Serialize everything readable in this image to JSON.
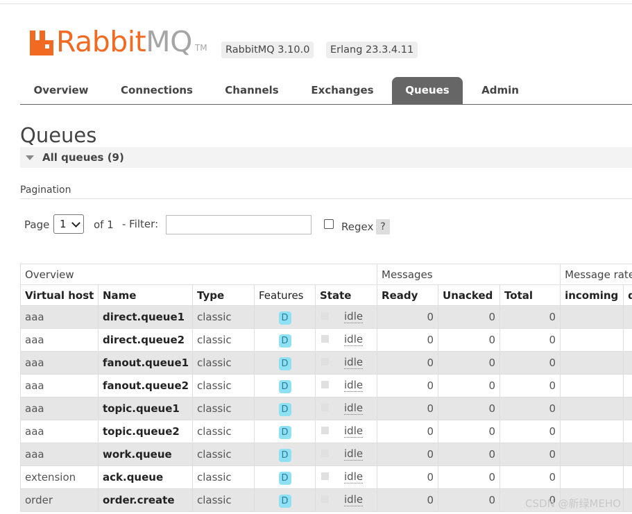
{
  "header": {
    "logo": {
      "brand": "Rabbit",
      "product": "MQ",
      "tm": "TM"
    },
    "version_badge": "RabbitMQ 3.10.0",
    "erlang_badge": "Erlang 23.3.4.11"
  },
  "tabs": [
    {
      "label": "Overview",
      "active": false
    },
    {
      "label": "Connections",
      "active": false
    },
    {
      "label": "Channels",
      "active": false
    },
    {
      "label": "Exchanges",
      "active": false
    },
    {
      "label": "Queues",
      "active": true
    },
    {
      "label": "Admin",
      "active": false
    }
  ],
  "page_title": "Queues",
  "section": {
    "title": "All queues (9)"
  },
  "pagination": {
    "label": "Pagination",
    "page_label": "Page",
    "page_value": "1",
    "of_label": "of 1",
    "filter_label": "- Filter:",
    "filter_value": "",
    "regex_label": "Regex",
    "regex_checked": false,
    "help_label": "?"
  },
  "table": {
    "groups": [
      "Overview",
      "Messages",
      "Message rate"
    ],
    "columns": [
      "Virtual host",
      "Name",
      "Type",
      "Features",
      "State",
      "Ready",
      "Unacked",
      "Total",
      "incoming",
      "d"
    ],
    "rows": [
      {
        "vhost": "aaa",
        "name": "direct.queue1",
        "type": "classic",
        "feature": "D",
        "state": "idle",
        "ready": "0",
        "unacked": "0",
        "total": "0"
      },
      {
        "vhost": "aaa",
        "name": "direct.queue2",
        "type": "classic",
        "feature": "D",
        "state": "idle",
        "ready": "0",
        "unacked": "0",
        "total": "0"
      },
      {
        "vhost": "aaa",
        "name": "fanout.queue1",
        "type": "classic",
        "feature": "D",
        "state": "idle",
        "ready": "0",
        "unacked": "0",
        "total": "0"
      },
      {
        "vhost": "aaa",
        "name": "fanout.queue2",
        "type": "classic",
        "feature": "D",
        "state": "idle",
        "ready": "0",
        "unacked": "0",
        "total": "0"
      },
      {
        "vhost": "aaa",
        "name": "topic.queue1",
        "type": "classic",
        "feature": "D",
        "state": "idle",
        "ready": "0",
        "unacked": "0",
        "total": "0"
      },
      {
        "vhost": "aaa",
        "name": "topic.queue2",
        "type": "classic",
        "feature": "D",
        "state": "idle",
        "ready": "0",
        "unacked": "0",
        "total": "0"
      },
      {
        "vhost": "aaa",
        "name": "work.queue",
        "type": "classic",
        "feature": "D",
        "state": "idle",
        "ready": "0",
        "unacked": "0",
        "total": "0"
      },
      {
        "vhost": "extension",
        "name": "ack.queue",
        "type": "classic",
        "feature": "D",
        "state": "idle",
        "ready": "0",
        "unacked": "0",
        "total": "0"
      },
      {
        "vhost": "order",
        "name": "order.create",
        "type": "classic",
        "feature": "D",
        "state": "idle",
        "ready": "0",
        "unacked": "0",
        "total": "0"
      }
    ]
  },
  "watermark": "CSDN @新绿MEHO",
  "colors": {
    "brand": "#f26a21",
    "tab_active": "#666666",
    "feature_badge": "#8ee1f3"
  }
}
